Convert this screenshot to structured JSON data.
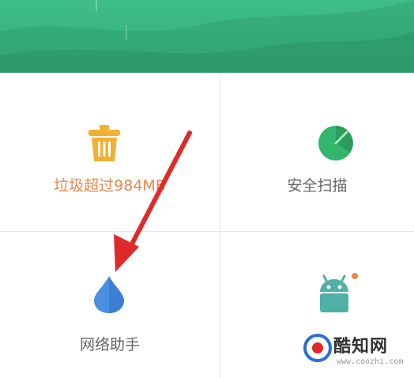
{
  "tiles": [
    {
      "label": "垃圾超过984MB",
      "icon": "trash-icon",
      "color": "#e9874a"
    },
    {
      "label": "安全扫描",
      "icon": "scan-shield-icon",
      "color": "#666666"
    },
    {
      "label": "网络助手",
      "icon": "water-drop-icon",
      "color": "#666666"
    },
    {
      "label": "",
      "icon": "android-app-icon",
      "color": "#666666"
    }
  ],
  "watermark": {
    "text": "酷知网",
    "url": "www.coozhi.com"
  },
  "colors": {
    "header": "#3fbf87",
    "trash": "#f2b030",
    "scan": "#32b56c",
    "drop": "#4b8fe0",
    "android": "#4fb0a6",
    "arrow": "#e02a2a",
    "warning": "#e9874a"
  }
}
